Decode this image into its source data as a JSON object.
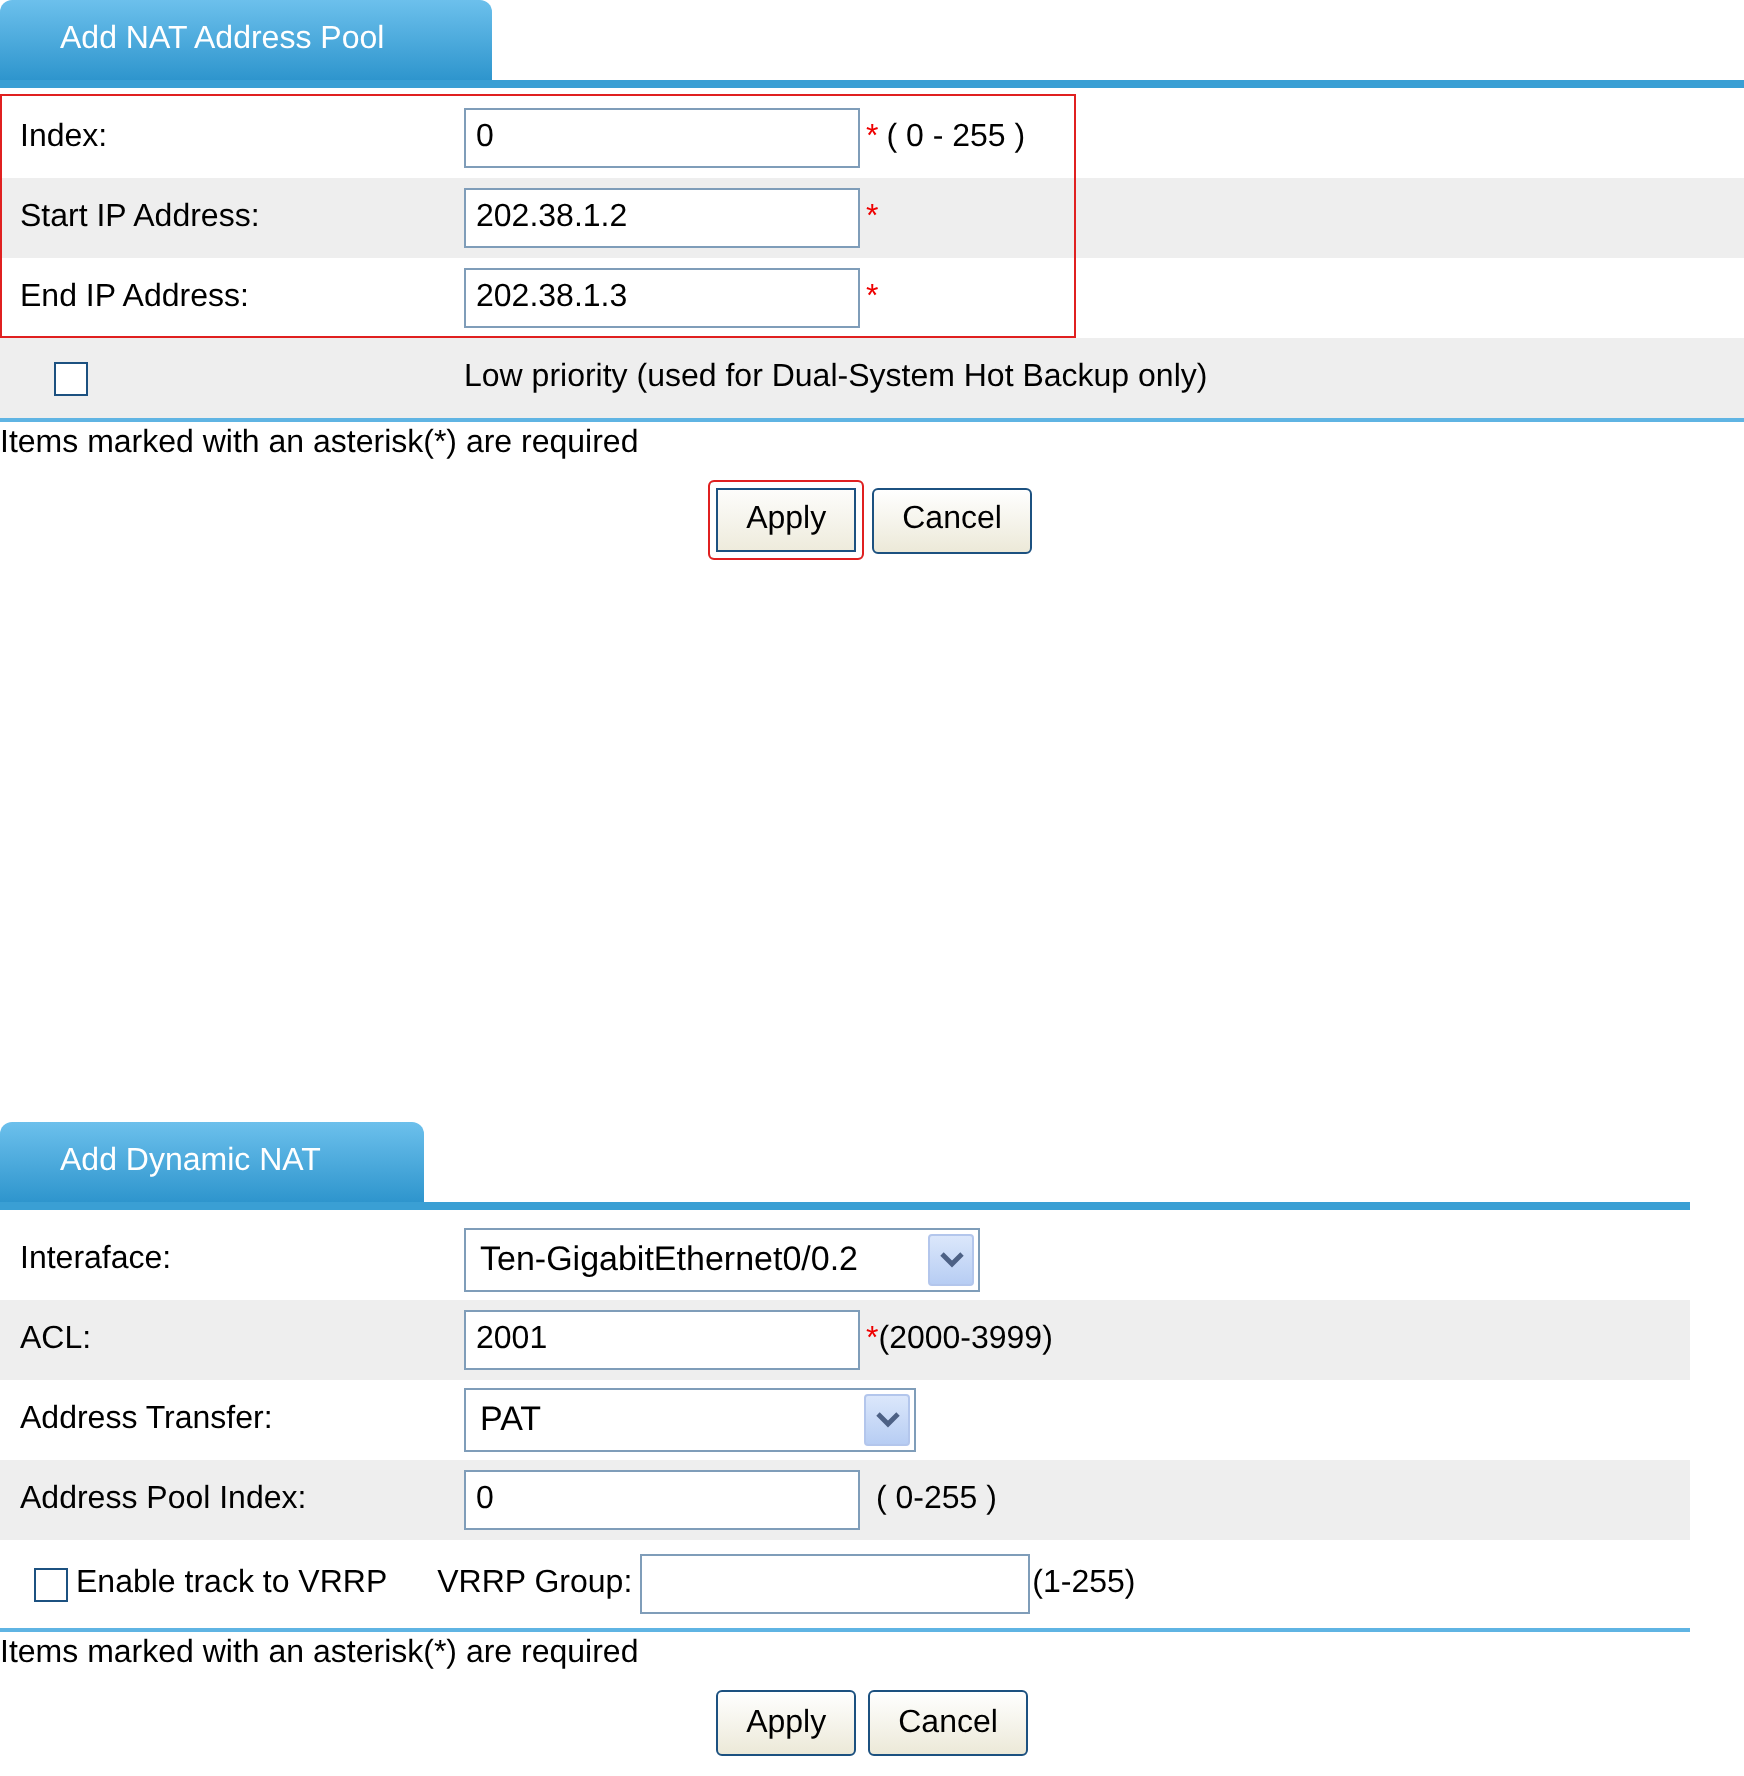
{
  "panels": [
    {
      "tab": "Add NAT Address Pool",
      "wide": true,
      "rows": [
        {
          "kind": "input",
          "label": "Index:",
          "value": "0",
          "mark": "*",
          "hint": "( 0 - 255 )",
          "highlighted": true
        },
        {
          "kind": "input",
          "label": "Start IP Address:",
          "value": "202.38.1.2",
          "mark": "*",
          "highlighted": true
        },
        {
          "kind": "input",
          "label": "End IP Address:",
          "value": "202.38.1.3",
          "mark": "*",
          "highlighted": true
        },
        {
          "kind": "checkbox",
          "label": "Low priority (used for Dual-System Hot Backup only)",
          "checked": false,
          "highlighted": false
        }
      ],
      "note": "Items marked with an asterisk(*) are required",
      "buttons": [
        {
          "label": "Apply",
          "highlighted": true
        },
        {
          "label": "Cancel",
          "highlighted": false
        }
      ]
    },
    {
      "tab": "Add Dynamic NAT",
      "wide": false,
      "rows": [
        {
          "kind": "select",
          "label": "Interaface:",
          "value": "Ten-GigabitEthernet0/0.2",
          "highlighted": false
        },
        {
          "kind": "input",
          "label": "ACL:",
          "value": "2001",
          "mark": "*",
          "hint": "(2000-3999)",
          "highlighted": false
        },
        {
          "kind": "select",
          "label": "Address Transfer:",
          "value": "PAT",
          "highlighted": false
        },
        {
          "kind": "input",
          "label": "Address Pool Index:",
          "value": "0",
          "hint": "( 0-255 )",
          "highlighted": false
        },
        {
          "kind": "track",
          "label": "Enable track to VRRP",
          "checked": false,
          "field_label": "VRRP Group:",
          "hint": "(1-255)",
          "highlighted": false
        }
      ],
      "note": "Items marked with an asterisk(*) are required",
      "buttons": [
        {
          "label": "Apply",
          "highlighted": false
        },
        {
          "label": "Cancel",
          "highlighted": false
        }
      ]
    }
  ]
}
